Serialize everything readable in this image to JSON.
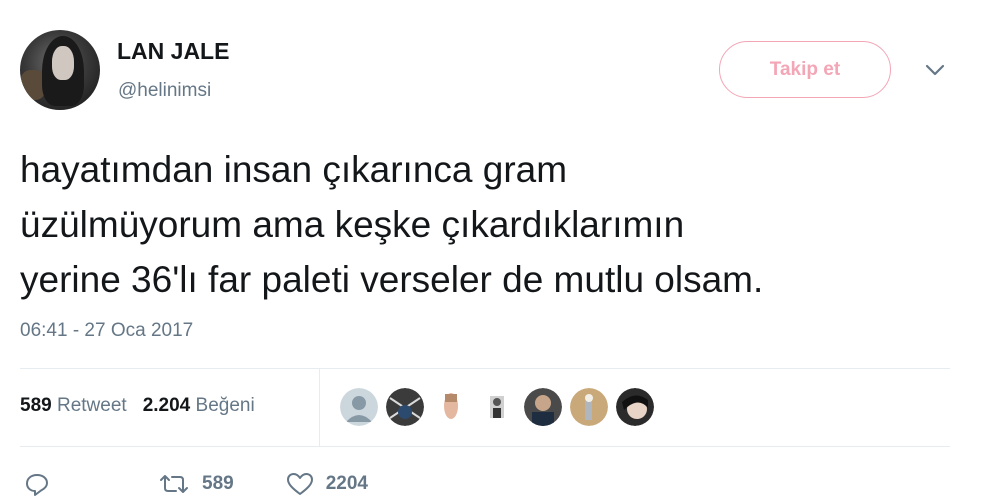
{
  "user": {
    "display_name": "LAN JALE",
    "handle": "@helinimsi",
    "avatar_icon": "profile-photo"
  },
  "follow_button": {
    "label": "Takip et",
    "color": "#f3a6b6"
  },
  "menu": {
    "icon": "chevron-down-icon"
  },
  "tweet": {
    "text": "hayatımdan insan çıkarınca gram\nüzülmüyorum ama keşke çıkardıklarımın\nyerine 36'lı far paleti verseler de mutlu olsam.",
    "timestamp": "06:41 - 27 Oca 2017"
  },
  "stats": {
    "retweets_count": "589",
    "retweets_label": "Retweet",
    "likes_count": "2.204",
    "likes_label": "Beğeni"
  },
  "likers": [
    {
      "icon": "default-avatar"
    },
    {
      "icon": "user-avatar"
    },
    {
      "icon": "user-avatar"
    },
    {
      "icon": "user-avatar"
    },
    {
      "icon": "user-avatar"
    },
    {
      "icon": "user-avatar"
    },
    {
      "icon": "user-avatar"
    }
  ],
  "actions": {
    "reply_icon": "reply-icon",
    "retweet_icon": "retweet-icon",
    "retweet_count": "589",
    "like_icon": "heart-icon",
    "like_count": "2204"
  },
  "colors": {
    "text": "#14171a",
    "secondary": "#657786",
    "divider": "#e6ecf0",
    "follow_accent": "#f3a6b6"
  }
}
